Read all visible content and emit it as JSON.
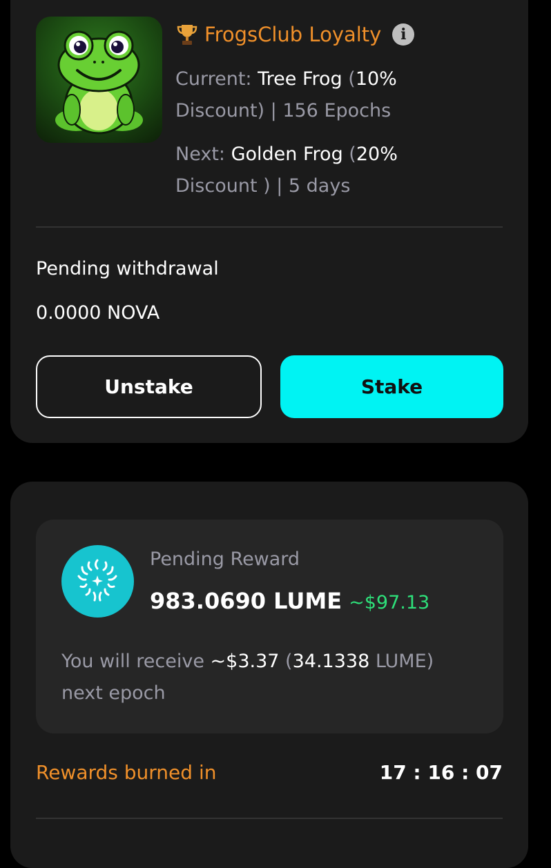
{
  "loyalty": {
    "title": "FrogsClub Loyalty",
    "current_prefix": "Current:",
    "current_tier": "Tree Frog",
    "current_paren_open": " (",
    "current_pct": "10%",
    "current_rest": "Discount) | 156 Epochs",
    "next_prefix": "Next:",
    "next_tier": "Golden Frog",
    "next_paren_open": " (",
    "next_pct": "20%",
    "next_rest": "Discount ) | 5 days"
  },
  "withdrawal": {
    "label": "Pending withdrawal",
    "value": "0.0000 NOVA"
  },
  "buttons": {
    "unstake": "Unstake",
    "stake": "Stake"
  },
  "reward": {
    "label": "Pending Reward",
    "amount": "983.0690 LUME",
    "usd": "~$97.13",
    "receive_prefix": "You will receive ",
    "receive_usd": "~$3.37",
    "receive_paren_open": " (",
    "receive_amount": "34.1338",
    "receive_unit_close": " LUME)",
    "receive_suffix": "next epoch"
  },
  "burn": {
    "label": "Rewards burned in",
    "timer": "17 : 16 : 07"
  },
  "colors": {
    "accent_orange": "#f0902a",
    "stake_cyan": "#00f3f3",
    "usd_green": "#2ee07a",
    "card_bg": "#1b1b1b"
  },
  "icons": {
    "trophy": "trophy-icon",
    "info": "info-icon",
    "lume": "lume-logo-icon"
  }
}
